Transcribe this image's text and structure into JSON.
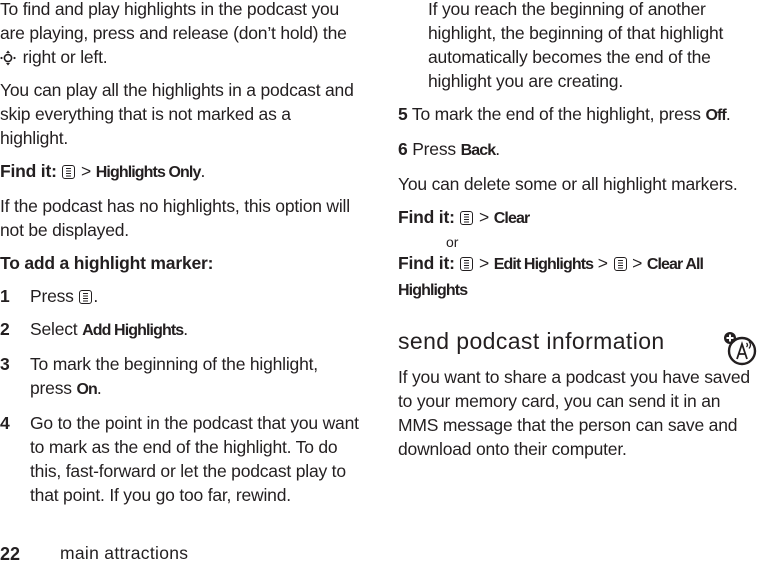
{
  "left_column": {
    "intro_1_a": "To find and play highlights in the podcast you are playing, press and release (don’t hold) the",
    "intro_1_b": " right or left.",
    "intro_2": "You can play all the highlights in a podcast and skip everything that is not marked as a highlight.",
    "find_it_1": {
      "label": "Find it:",
      "sep": " > ",
      "item": "Highlights Only",
      "end": "."
    },
    "note": "If the podcast has no highlights, this option will not be displayed.",
    "subheading": "To add a highlight marker:",
    "steps": [
      {
        "num": "1",
        "text_a": "Press ",
        "text_b": "."
      },
      {
        "num": "2",
        "text_a": "Select ",
        "cmd": "Add Highlights",
        "text_b": "."
      },
      {
        "num": "3",
        "text_a": "To mark the beginning of the highlight, press ",
        "cmd": "On",
        "text_b": "."
      },
      {
        "num": "4",
        "text_a": "Go to the point in the podcast that you want to mark as the end of the highlight. To do this, fast-forward or let the podcast play to that point. If you go too far, rewind."
      }
    ]
  },
  "right_column": {
    "step4_cont": "If you reach the beginning of another highlight, the beginning of that highlight automatically becomes the end of the highlight you are creating.",
    "step5": {
      "num": "5",
      "text_a": " To mark the end of the highlight, press ",
      "cmd": "Off",
      "text_b": "."
    },
    "step6": {
      "num": "6",
      "text_a": " Press ",
      "cmd": "Back",
      "text_b": "."
    },
    "delete_note": "You can delete some or all highlight markers.",
    "find_it_2": {
      "label": "Find it:",
      "sep": " > ",
      "item": "Clear"
    },
    "or_text": "or",
    "find_it_3": {
      "label": "Find it:",
      "sep": " > ",
      "item_1": "Edit Highlights",
      "item_2": "Clear All Highlights"
    }
  },
  "section": {
    "title": "send podcast information",
    "icon": "network-feature-icon",
    "body": "If you want to share a podcast you have saved to your memory card, you can send it in an MMS message that the person can save and download onto their computer."
  },
  "footer": {
    "page_number": "22",
    "chapter": "main attractions"
  },
  "icons": {
    "menu_key": "menu-key-icon",
    "nav_key": "navigation-key-icon"
  }
}
